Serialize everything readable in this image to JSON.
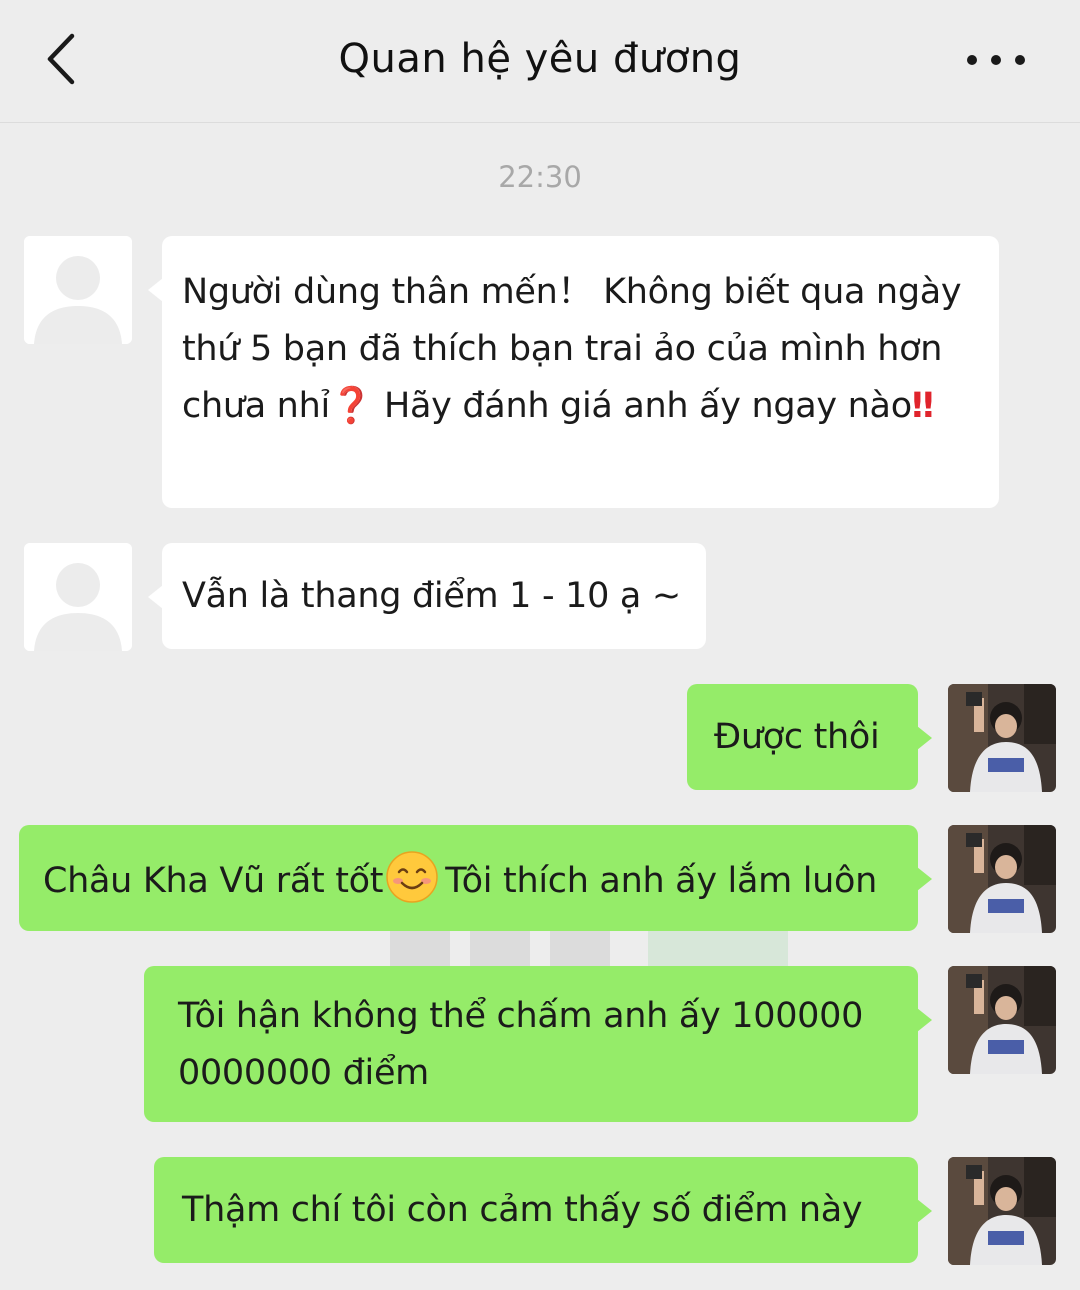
{
  "header": {
    "title": "Quan hệ yêu đương"
  },
  "chat": {
    "timestamp": "22:30",
    "messages": [
      {
        "side": "in",
        "parts": [
          "Người dùng thân mến！ Không biết qua ngày thứ 5 bạn đã thích bạn trai ảo của mình hơn chưa nhỉ",
          "❓",
          " Hãy đánh giá anh ấy ngay nào",
          "‼"
        ]
      },
      {
        "side": "in",
        "text": "Vẫn là thang điểm 1 - 10 ạ ~"
      },
      {
        "side": "out",
        "text": "Được thôi"
      },
      {
        "side": "out",
        "text_before": "Châu Kha Vũ rất tốt",
        "text_after": "Tôi thích anh ấy lắm luôn"
      },
      {
        "side": "out",
        "text": "Tôi hận không thể chấm anh ấy 100000 0000000 điểm"
      },
      {
        "side": "out",
        "text": "Thậm chí tôi còn cảm thấy số điểm này"
      }
    ]
  },
  "icons": {
    "back": "chevron-left-icon",
    "more": "more-dots-icon",
    "default_avatar": "person-silhouette-icon",
    "smile": "smiling-face-emoji"
  },
  "colors": {
    "background": "#ededed",
    "incoming_bubble": "#ffffff",
    "outgoing_bubble": "#95ec69",
    "timestamp": "#a8a8a8",
    "emoji_red": "#e0242c"
  }
}
